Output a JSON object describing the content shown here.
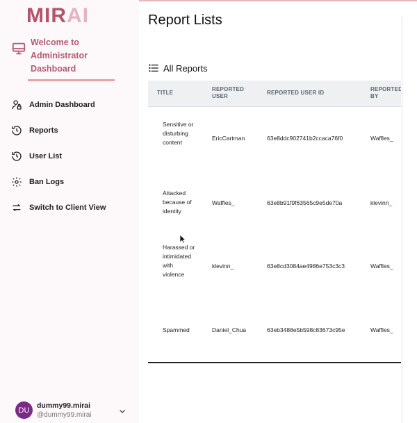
{
  "brand": {
    "logo_main": "MIR",
    "logo_fade": "AI"
  },
  "sidebar": {
    "welcome": "Welcome to Administrator Dashboard",
    "items": [
      {
        "label": "Admin Dashboard",
        "icon": "admin-user-icon"
      },
      {
        "label": "Reports",
        "icon": "history-icon"
      },
      {
        "label": "User List",
        "icon": "history-icon"
      },
      {
        "label": "Ban Logs",
        "icon": "gear-icon"
      },
      {
        "label": "Switch to Client View",
        "icon": "swap-arrows-icon"
      }
    ],
    "user": {
      "initials": "DU",
      "name": "dummy99.mirai",
      "handle": "@dummy99.mirai"
    }
  },
  "main": {
    "title": "Report Lists",
    "section": "All Reports",
    "columns": [
      "TITLE",
      "REPORTED USER",
      "REPORTED USER ID",
      "REPORTED BY"
    ],
    "rows": [
      {
        "title": "Sensitive or disturbing content",
        "reported_user": "EricCartman",
        "reported_user_id": "63e8ddc902741b2ccaca76f0",
        "reported_by": "Waffles_"
      },
      {
        "title": "Attacked because of identity",
        "reported_user": "Waffles_",
        "reported_user_id": "63e8b91f9f63565c9e5de70a",
        "reported_by": "klevinn_"
      },
      {
        "title": "Harassed or intimidated with violence",
        "reported_user": "klevinn_",
        "reported_user_id": "63e8cd3084ae4986e753c3c3",
        "reported_by": "Waffles_"
      },
      {
        "title": "Spammed",
        "reported_user": "Daniel_Chua",
        "reported_user_id": "63eb3488e5b598c83673c95e",
        "reported_by": "Waffles_"
      }
    ]
  },
  "colors": {
    "brand": "#b4546a",
    "welcome": "#b55b70",
    "divider": "#e6a5a5",
    "avatar": "#7b2b86",
    "header_bg": "#eef0f2"
  }
}
